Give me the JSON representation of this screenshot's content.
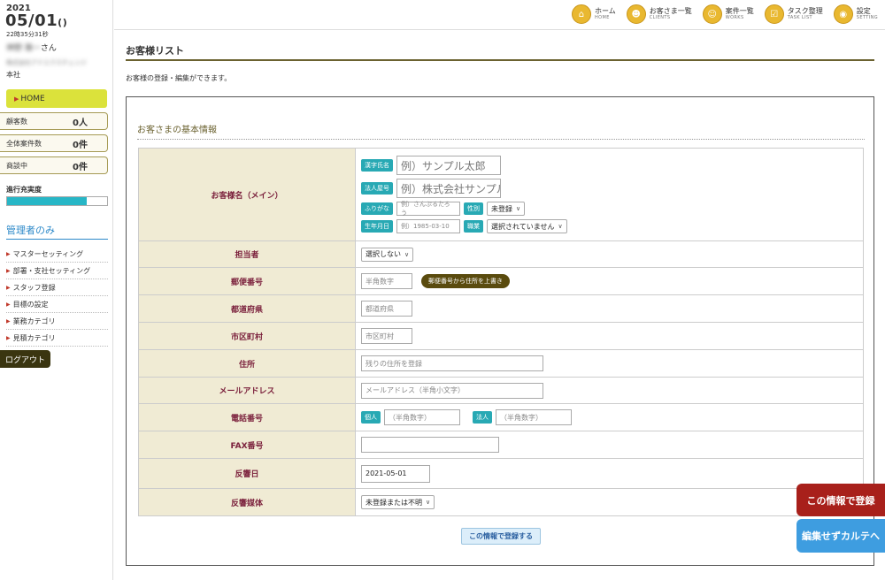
{
  "sidebar": {
    "year": "2021",
    "date": "05/01",
    "date_paren": "()",
    "time": "22時35分31秒",
    "user_name": "神野 雅一",
    "user_suffix": "さん",
    "user_company": "株式会社アドエクスチェンジ",
    "branch": "本社",
    "home_label": "HOME",
    "stats": [
      {
        "label": "顧客数",
        "value": "0人"
      },
      {
        "label": "全体案件数",
        "value": "0件"
      },
      {
        "label": "商談中",
        "value": "0件"
      }
    ],
    "progress_label": "進行充実度",
    "progress_value": 0.8,
    "admin_title": "管理者のみ",
    "admin_menu": [
      "マスターセッティング",
      "部署・支社セッティング",
      "スタッフ登録",
      "目標の設定",
      "業務カテゴリ",
      "見積カテゴリ"
    ],
    "logout_label": "ログアウト"
  },
  "topnav": [
    {
      "label": "ホーム",
      "sub": "HOME",
      "icon": "home-icon",
      "glyph": "⌂"
    },
    {
      "label": "お客さま一覧",
      "sub": "CLIENTS",
      "icon": "clients-icon",
      "glyph": "☻"
    },
    {
      "label": "案件一覧",
      "sub": "WORKS",
      "icon": "works-icon",
      "glyph": "☺"
    },
    {
      "label": "タスク整理",
      "sub": "TASK LIST",
      "icon": "task-icon",
      "glyph": "☑"
    },
    {
      "label": "設定",
      "sub": "SETTING",
      "icon": "gear-icon",
      "glyph": "◉"
    }
  ],
  "page": {
    "title": "お客様リスト",
    "description": "お客様の登録・編集ができます。"
  },
  "form": {
    "section_title": "お客さまの基本情報",
    "customer_name_label": "お客様名（メイン）",
    "kanji_tag": "漢字氏名",
    "kanji_placeholder": "例）サンプル太郎",
    "corp_tag": "法人屋号",
    "corp_placeholder": "例）株式会社サンプル",
    "kana_tag": "ふりがな",
    "kana_placeholder": "例）さんぷるたろう",
    "gender_tag": "性別",
    "gender_value": "未登録",
    "birth_tag": "生年月日",
    "birth_placeholder": "例）1985-03-10",
    "job_tag": "職業",
    "job_value": "選択されていません",
    "staff_label": "担当者",
    "staff_value": "選択しない",
    "zip_label": "郵便番号",
    "zip_placeholder": "半角数字",
    "zip_button": "郵便番号から住所を上書き",
    "pref_label": "都道府県",
    "pref_placeholder": "都道府県",
    "city_label": "市区町村",
    "city_placeholder": "市区町村",
    "address_label": "住所",
    "address_placeholder": "残りの住所を登録",
    "email_label": "メールアドレス",
    "email_placeholder": "メールアドレス（半角小文字）",
    "phone_label": "電話番号",
    "phone_personal_tag": "個人",
    "phone_personal_placeholder": "（半角数字）",
    "phone_corp_tag": "法人",
    "phone_corp_placeholder": "（半角数字）",
    "fax_label": "FAX番号",
    "fax_value": "",
    "response_date_label": "反響日",
    "response_date_value": "2021-05-01",
    "media_label": "反響媒体",
    "media_value": "未登録または不明",
    "submit_label": "この情報で登録する"
  },
  "floating": {
    "register_label": "この情報で登録",
    "karte_label": "編集せずカルテへ"
  },
  "colors": {
    "accent_olive": "#6b6230",
    "home_yellow": "#dbe23b",
    "tag_teal": "#28a9b4",
    "label_maroon": "#7a1f3b",
    "register_red": "#a8201b",
    "karte_blue": "#3e9de0"
  }
}
